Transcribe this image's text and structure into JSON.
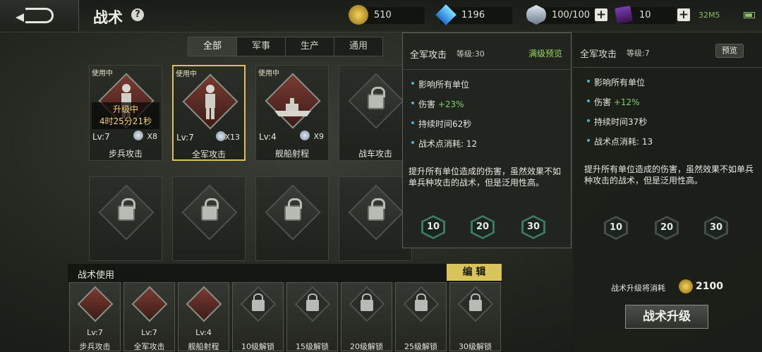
{
  "header": {
    "title": "战术",
    "help": "?",
    "gold": "510",
    "diamond": "1196",
    "energy": "100/100",
    "cards": "10",
    "signal": "32M5"
  },
  "tabs": [
    "全部",
    "军事",
    "生产",
    "通用"
  ],
  "cards": [
    {
      "badge": "使用中",
      "lv": "Lv:7",
      "count": "X8",
      "name": "步兵攻击",
      "upgrading": true,
      "upgrade_line1": "升级中",
      "upgrade_line2": "4时25分21秒"
    },
    {
      "badge": "使用中",
      "lv": "Lv:7",
      "count": "X13",
      "name": "全军攻击",
      "selected": true
    },
    {
      "badge": "使用中",
      "lv": "Lv:4",
      "count": "X9",
      "name": "舰船射程"
    },
    {
      "badge": "",
      "lv": "",
      "count": "",
      "name": "战车攻击",
      "locked": true
    }
  ],
  "tooltip": {
    "name": "全军攻击",
    "level": "等级:30",
    "max_preview": "满级预览",
    "stats": [
      {
        "label": "影响所有单位",
        "value": ""
      },
      {
        "label": "伤害",
        "value": "+23%"
      },
      {
        "label": "持续时间62秒",
        "value": ""
      },
      {
        "label": "战术点消耗:",
        "value": "12"
      }
    ],
    "description": "提升所有单位造成的伤害，虽然效果不如单兵种攻击的战术，但是泛用性高。",
    "levels": [
      "10",
      "20",
      "30"
    ]
  },
  "right_panel": {
    "name": "全军攻击",
    "level": "等级:7",
    "preview": "预览",
    "stats": [
      {
        "label": "影响所有单位",
        "value": ""
      },
      {
        "label": "伤害",
        "value": "+12%"
      },
      {
        "label": "持续时间37秒",
        "value": ""
      },
      {
        "label": "战术点消耗:",
        "value": "13"
      }
    ],
    "description": "提升所有单位造成的伤害，虽然效果不如单兵种攻击的战术，但是泛用性高。",
    "levels": [
      "10",
      "20",
      "30"
    ],
    "cost_label": "战术升级将消耗",
    "cost": "2100",
    "upgrade_button": "战术升级"
  },
  "bottom_bar": {
    "title": "战术使用",
    "edit": "编 辑",
    "slots": [
      {
        "lv": "Lv:7",
        "name": "步兵攻击",
        "locked": false
      },
      {
        "lv": "Lv:7",
        "name": "全军攻击",
        "locked": false
      },
      {
        "lv": "Lv:4",
        "name": "舰船射程",
        "locked": false
      },
      {
        "lv": "",
        "name": "10级解锁",
        "locked": true
      },
      {
        "lv": "",
        "name": "15级解锁",
        "locked": true
      },
      {
        "lv": "",
        "name": "20级解锁",
        "locked": true
      },
      {
        "lv": "",
        "name": "25级解锁",
        "locked": true
      },
      {
        "lv": "",
        "name": "30级解锁",
        "locked": true
      }
    ]
  },
  "colors": {
    "accent_green": "#7fd36a",
    "edit_gold": "#d9c45b",
    "select_border": "#d9c25c",
    "bullet_blue": "#4fb1d6"
  }
}
